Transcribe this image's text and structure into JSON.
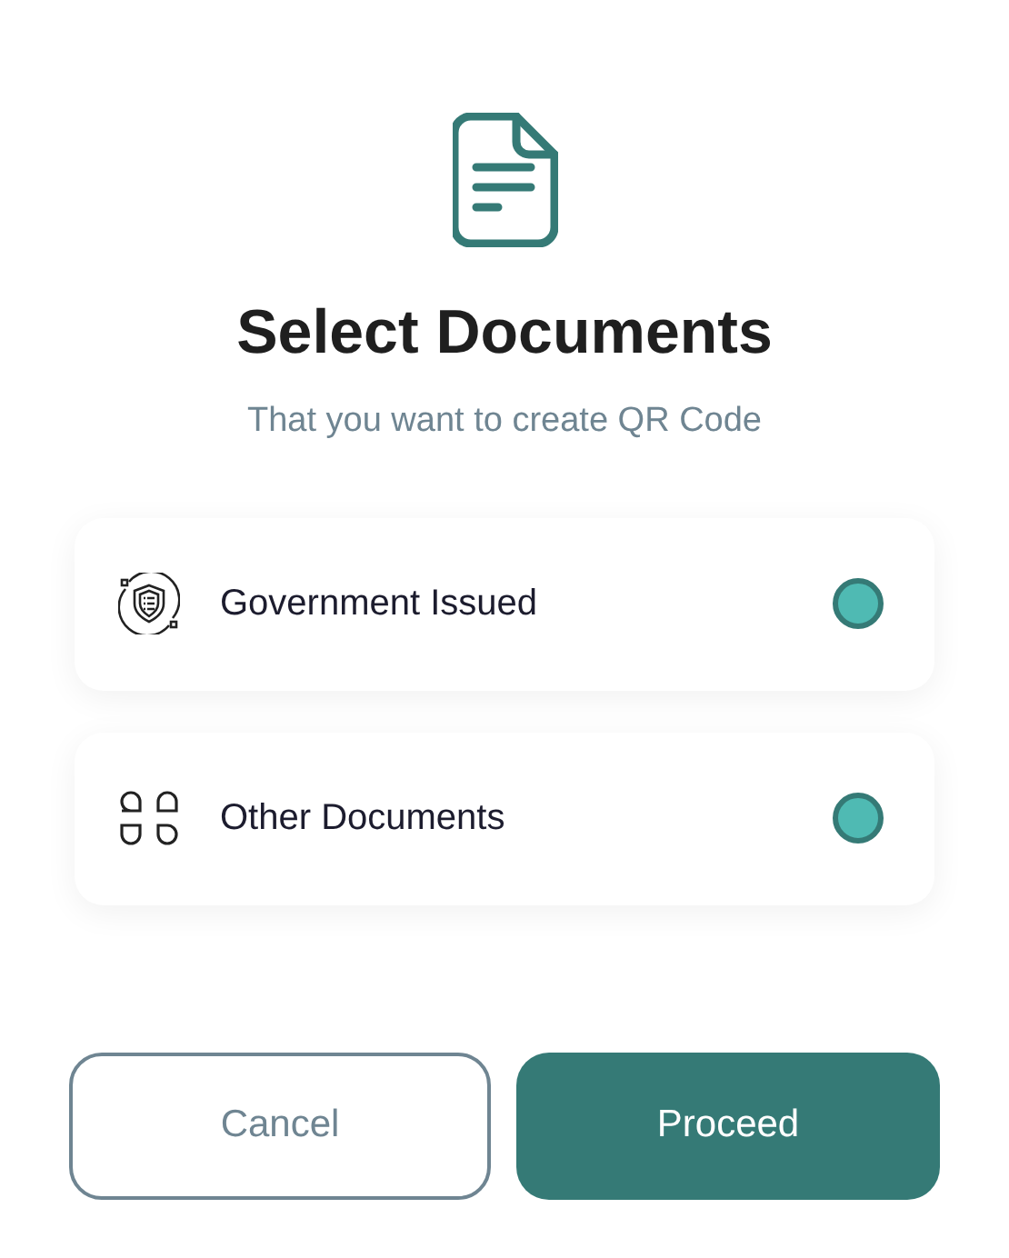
{
  "title": "Select Documents",
  "subtitle": "That you want to create QR Code",
  "options": [
    {
      "kind": "shield",
      "label": "Government Issued",
      "selected": true
    },
    {
      "kind": "grid",
      "label": "Other Documents",
      "selected": true
    }
  ],
  "buttons": [
    {
      "kind": "secondary",
      "label": "Cancel"
    },
    {
      "kind": "primary",
      "label": "Proceed"
    }
  ]
}
